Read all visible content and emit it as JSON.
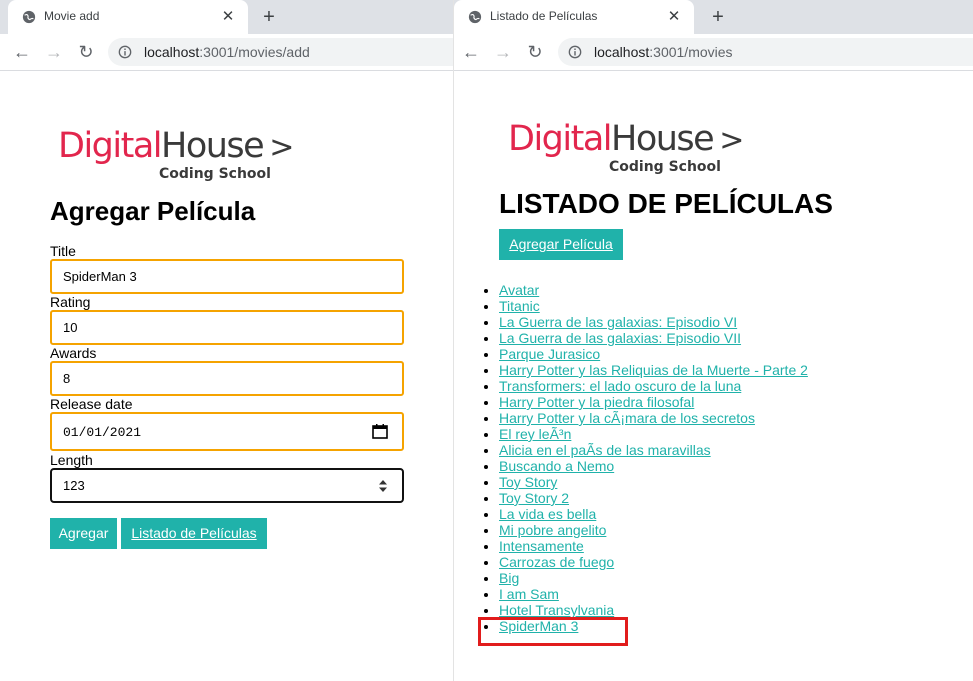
{
  "left_window": {
    "tab": {
      "title": "Movie add",
      "icon": "globe-icon"
    },
    "toolbar": {
      "url_host": "localhost",
      "url_path": ":3001/movies/add"
    },
    "logo": {
      "brand_part1": "Digital",
      "brand_part2": "House",
      "caret": ">",
      "subtitle": "Coding School"
    },
    "heading": "Agregar Película",
    "form": {
      "fields": [
        {
          "label": "Title",
          "value": "SpiderMan 3"
        },
        {
          "label": "Rating",
          "value": "10"
        },
        {
          "label": "Awards",
          "value": "8"
        },
        {
          "label": "Release date",
          "value": "01/01/2021"
        },
        {
          "label": "Length",
          "value": "123"
        }
      ],
      "submit_label": "Agregar",
      "list_link_label": "Listado de Películas"
    }
  },
  "right_window": {
    "tab": {
      "title": "Listado de Películas",
      "icon": "globe-icon"
    },
    "toolbar": {
      "url_host": "localhost",
      "url_path": ":3001/movies"
    },
    "logo": {
      "brand_part1": "Digital",
      "brand_part2": "House",
      "caret": ">",
      "subtitle": "Coding School"
    },
    "heading": "LISTADO DE PELÍCULAS",
    "add_button_label": "Agregar Película",
    "movies": [
      "Avatar",
      "Titanic",
      "La Guerra de las galaxias: Episodio VI",
      "La Guerra de las galaxias: Episodio VII",
      "Parque Jurasico",
      "Harry Potter y las Reliquias de la Muerte - Parte 2",
      "Transformers: el lado oscuro de la luna",
      "Harry Potter y la piedra filosofal",
      "Harry Potter y la cÃ¡mara de los secretos",
      "El rey leÃ³n",
      "Alicia en el paÃ­s de las maravillas",
      "Buscando a Nemo",
      "Toy Story",
      "Toy Story 2",
      "La vida es bella",
      "Mi pobre angelito",
      "Intensamente",
      "Carrozas de fuego",
      "Big",
      "I am Sam",
      "Hotel Transylvania",
      "SpiderMan 3"
    ],
    "highlighted_item": "SpiderMan 3"
  },
  "colors": {
    "accent": "#20b2aa",
    "brand_red": "#e2264d",
    "field_border": "#f5a300",
    "highlight_box": "#e11c1c"
  }
}
